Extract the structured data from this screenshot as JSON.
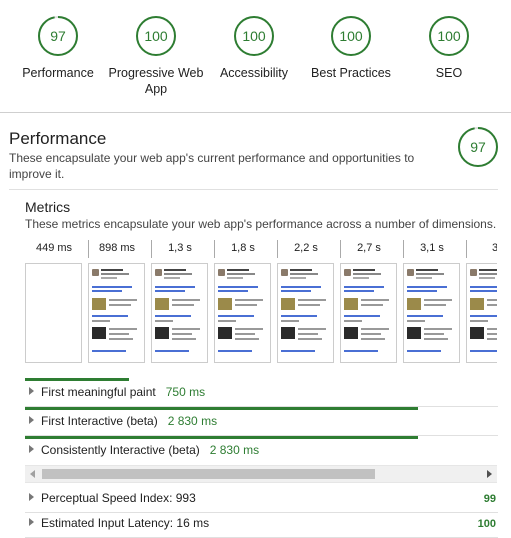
{
  "accent_color": "#2e7d32",
  "top_gauges": [
    {
      "score": "97",
      "label": "Performance"
    },
    {
      "score": "100",
      "label": "Progressive Web App"
    },
    {
      "score": "100",
      "label": "Accessibility"
    },
    {
      "score": "100",
      "label": "Best Practices"
    },
    {
      "score": "100",
      "label": "SEO"
    }
  ],
  "performance": {
    "title": "Performance",
    "description": "These encapsulate your web app's current performance and opportunities to improve it.",
    "score": "97"
  },
  "metrics": {
    "title": "Metrics",
    "description": "These metrics encapsulate your web app's performance across a number of dimensions.",
    "filmstrip_times": [
      "449 ms",
      "898 ms",
      "1,3 s",
      "1,8 s",
      "2,2 s",
      "2,7 s",
      "3,1 s",
      "3"
    ],
    "rows": [
      {
        "name": "First meaningful paint",
        "value": "750 ms",
        "bar_fraction": 0.22
      },
      {
        "name": "First Interactive (beta)",
        "value": "2 830 ms",
        "bar_fraction": 0.83
      },
      {
        "name": "Consistently Interactive (beta)",
        "value": "2 830 ms",
        "bar_fraction": 0.83
      }
    ],
    "scored_rows": [
      {
        "name": "Perceptual Speed Index: 993",
        "score": "99"
      },
      {
        "name": "Estimated Input Latency: 16 ms",
        "score": "100"
      }
    ]
  }
}
